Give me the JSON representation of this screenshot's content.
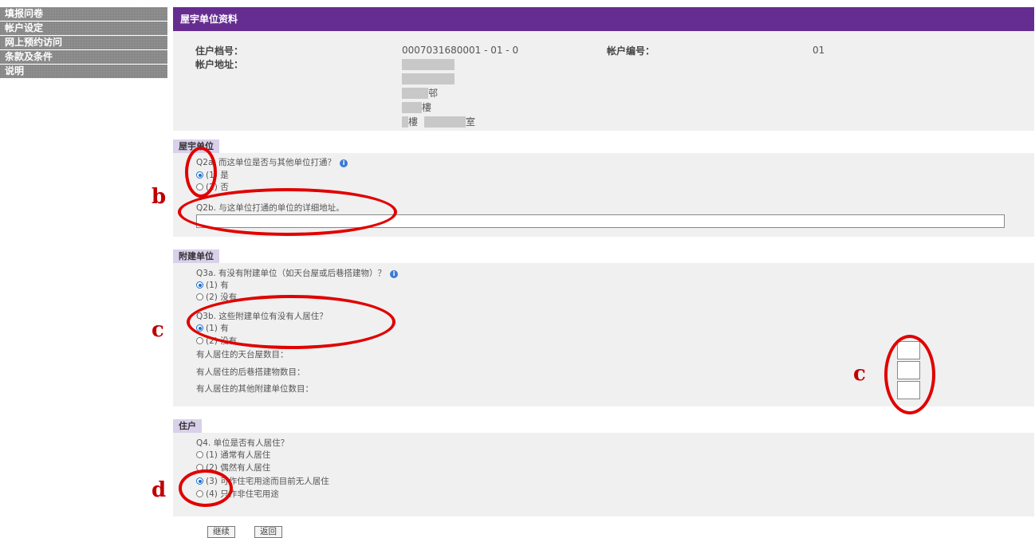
{
  "menu": {
    "items": [
      {
        "label": "填报问卷"
      },
      {
        "label": "帐户设定"
      },
      {
        "label": "网上预约访问"
      },
      {
        "label": "条款及条件"
      },
      {
        "label": "说明"
      }
    ]
  },
  "header": {
    "title": "屋宇单位资料"
  },
  "account": {
    "file_no_label": "住户档号：",
    "file_no_value": "0007031680001 - 01 - 0",
    "account_no_label": "帐户编号：",
    "account_no_value": "01",
    "address_label": "帐户地址：",
    "address_lines": [
      "",
      "",
      "邨",
      "樓",
      "樓",
      "室"
    ]
  },
  "sections": {
    "building_unit": {
      "tab": "屋宇单位",
      "q2a": "Q2a. 而这单位是否与其他单位打通？",
      "q2a_opt1": "(1) 是",
      "q2a_opt2": "(2) 否",
      "q2b": "Q2b. 与这单位打通的单位的详细地址。",
      "q2b_value": ""
    },
    "annex": {
      "tab": "附建单位",
      "q3a": "Q3a. 有没有附建单位（如天台屋或后巷搭建物）？",
      "q3a_opt1": "(1) 有",
      "q3a_opt2": "(2) 没有",
      "q3b": "Q3b. 这些附建单位有没有人居住？",
      "q3b_opt1": "(1) 有",
      "q3b_opt2": "(2) 没有",
      "count1": "有人居住的天台屋数目：",
      "count2": "有人居住的后巷搭建物数目：",
      "count3": "有人居住的其他附建单位数目："
    },
    "household": {
      "tab": "住户",
      "q4": "Q4. 单位是否有人居住？",
      "q4_opt1": "(1) 通常有人居住",
      "q4_opt2": "(2) 偶然有人居住",
      "q4_opt3": "(3) 可作住宅用途而目前无人居住",
      "q4_opt4": "(4) 只作非住宅用途"
    }
  },
  "buttons": {
    "continue": "继续",
    "back": "返回"
  },
  "annotations": {
    "b": "b",
    "c1": "c",
    "c2": "c",
    "d": "d",
    "color": "#e00000"
  },
  "icons": {
    "info": "info-icon"
  }
}
